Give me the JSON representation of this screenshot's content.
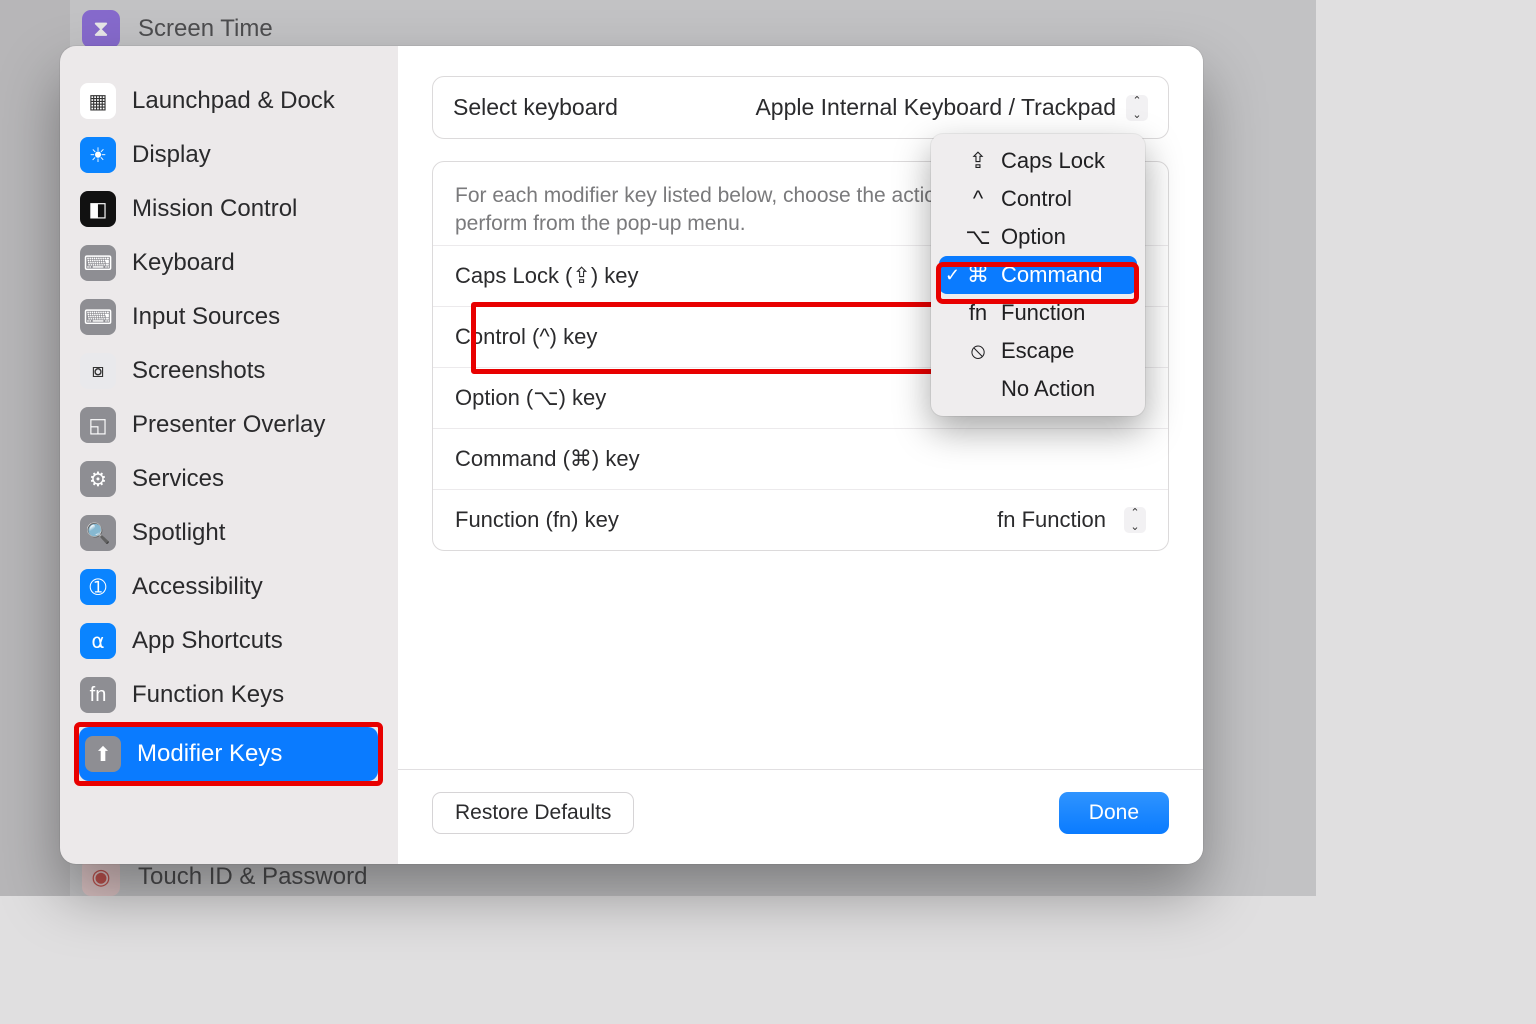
{
  "background": {
    "row1": {
      "label": "Screen Time"
    },
    "row2": {
      "label": "Touch ID & Password"
    }
  },
  "sidebar": {
    "items": [
      {
        "label": "Launchpad & Dock",
        "icon_bg": "#ffffff",
        "icon_color": "#333",
        "glyph": "▦"
      },
      {
        "label": "Display",
        "icon_bg": "#0a84ff",
        "glyph": "☀"
      },
      {
        "label": "Mission Control",
        "icon_bg": "#111111",
        "glyph": "◧"
      },
      {
        "label": "Keyboard",
        "icon_bg": "#8e8e93",
        "glyph": "⌨"
      },
      {
        "label": "Input Sources",
        "icon_bg": "#8e8e93",
        "glyph": "⌨"
      },
      {
        "label": "Screenshots",
        "icon_bg": "#e9e9ec",
        "icon_color": "#333",
        "glyph": "⧇"
      },
      {
        "label": "Presenter Overlay",
        "icon_bg": "#8e8e93",
        "glyph": "◱"
      },
      {
        "label": "Services",
        "icon_bg": "#8e8e93",
        "glyph": "⚙"
      },
      {
        "label": "Spotlight",
        "icon_bg": "#8e8e93",
        "glyph": "🔍"
      },
      {
        "label": "Accessibility",
        "icon_bg": "#0a84ff",
        "glyph": "➀"
      },
      {
        "label": "App Shortcuts",
        "icon_bg": "#0a84ff",
        "glyph": "⍺"
      },
      {
        "label": "Function Keys",
        "icon_bg": "#8e8e93",
        "glyph": "fn"
      },
      {
        "label": "Modifier Keys",
        "icon_bg": "#8e8e93",
        "glyph": "⬆"
      }
    ],
    "selected_index": 12
  },
  "main": {
    "select_label": "Select keyboard",
    "select_value": "Apple Internal Keyboard / Trackpad",
    "description": "For each modifier key listed below, choose the action you want it to perform from the pop-up menu.",
    "rows": [
      {
        "label": "Caps Lock (⇪) key",
        "value": ""
      },
      {
        "label": "Control (^) key",
        "value": ""
      },
      {
        "label": "Option (⌥) key",
        "value": ""
      },
      {
        "label": "Command (⌘) key",
        "value": ""
      },
      {
        "label": "Function (fn) key",
        "value": "fn Function"
      }
    ],
    "highlighted_row": 1
  },
  "popover": {
    "items": [
      {
        "symbol": "⇪",
        "label": "Caps Lock"
      },
      {
        "symbol": "^",
        "label": "Control"
      },
      {
        "symbol": "⌥",
        "label": "Option"
      },
      {
        "symbol": "⌘",
        "label": "Command"
      },
      {
        "symbol": "fn",
        "label": "Function"
      },
      {
        "symbol": "⦸",
        "label": "Escape"
      },
      {
        "symbol": "",
        "label": "No Action"
      }
    ],
    "selected_index": 3
  },
  "footer": {
    "restore": "Restore Defaults",
    "done": "Done"
  }
}
